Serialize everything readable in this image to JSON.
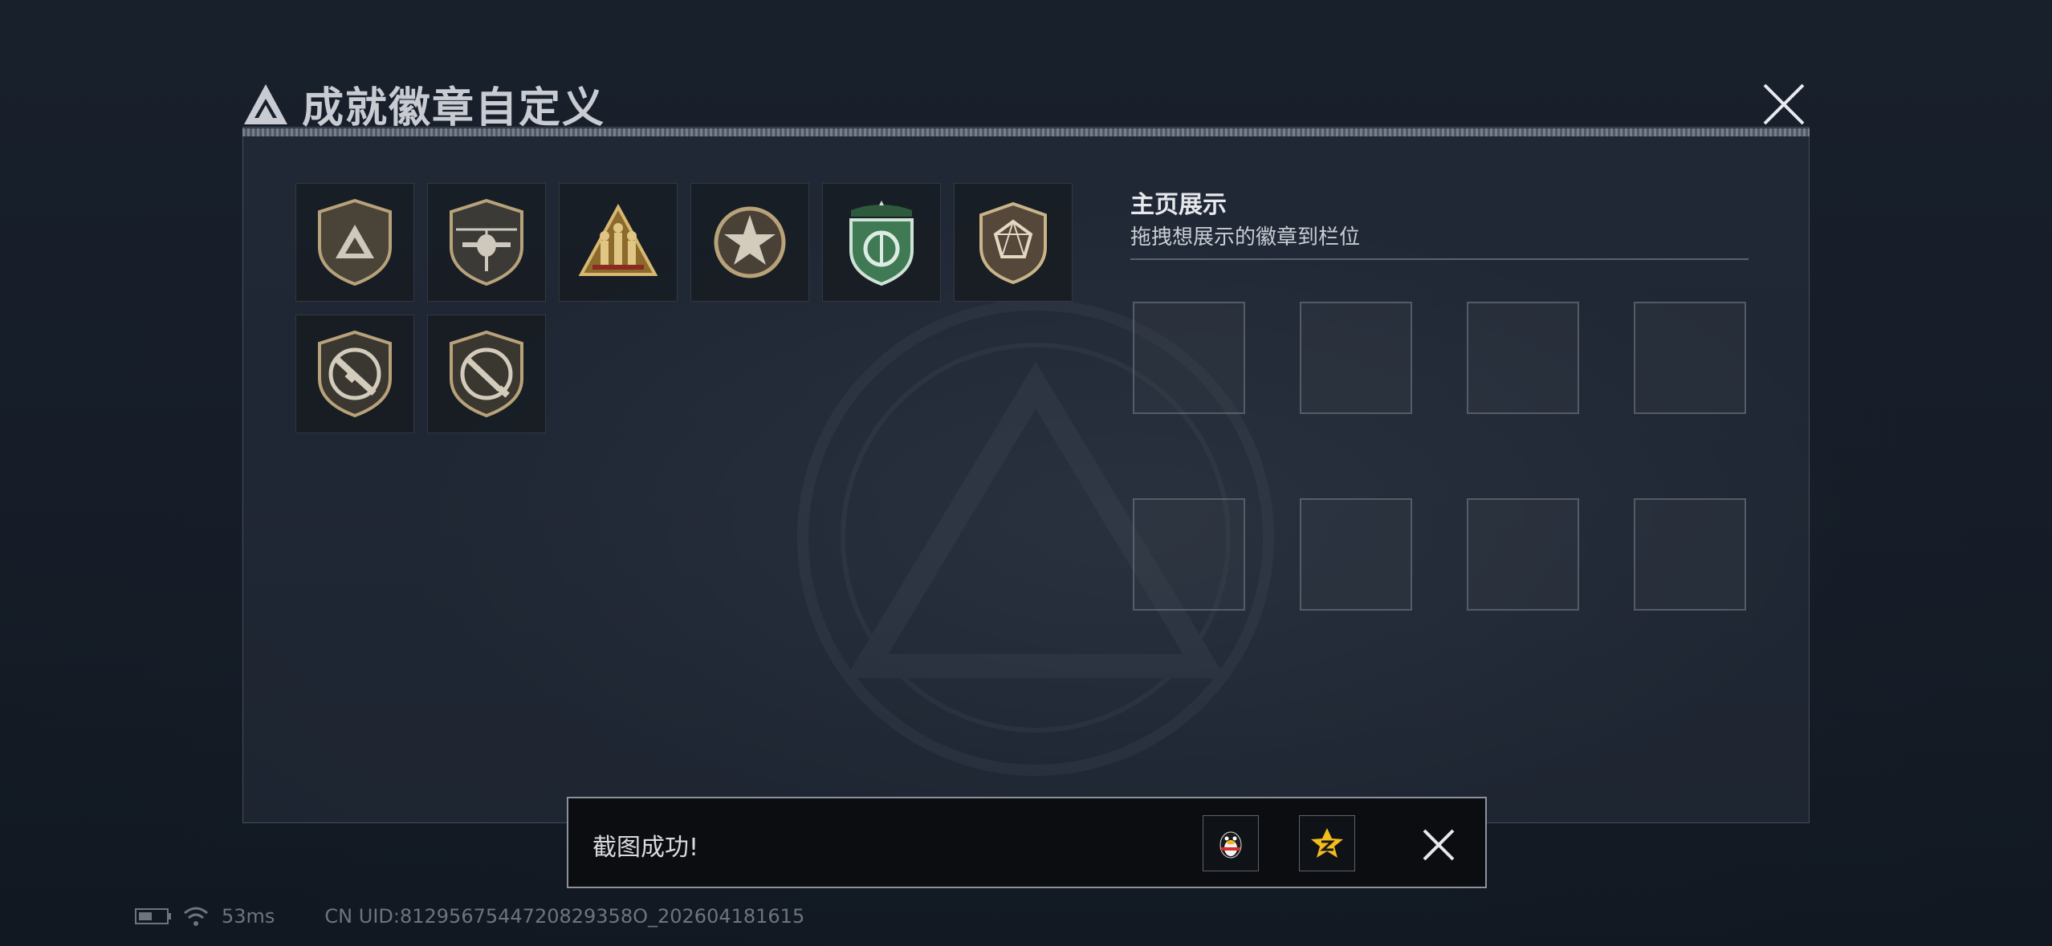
{
  "header": {
    "title": "成就徽章自定义",
    "logo_icon": "triangle-logo-icon",
    "close_icon": "close-icon"
  },
  "badges": [
    {
      "name": "triangle-shield-badge-icon"
    },
    {
      "name": "helicopter-badge-icon"
    },
    {
      "name": "soldiers-triangle-badge-icon"
    },
    {
      "name": "star-badge-icon"
    },
    {
      "name": "green-shield-badge-icon"
    },
    {
      "name": "gem-shield-badge-icon"
    },
    {
      "name": "rifle-badge-icon"
    },
    {
      "name": "knife-badge-icon"
    }
  ],
  "showcase": {
    "title": "主页展示",
    "subtitle": "拖拽想展示的徽章到栏位",
    "slot_count": 8
  },
  "toast": {
    "message": "截图成功!",
    "share_qq_icon": "qq-penguin-icon",
    "share_qzone_icon": "qzone-star-icon",
    "close_icon": "close-icon"
  },
  "status_bar": {
    "battery_icon": "battery-icon",
    "wifi_icon": "wifi-icon",
    "ping": "53ms",
    "uid": "CN UID:8129567544720829358O_202604181615"
  },
  "colors": {
    "gold": "#b8a27a",
    "green": "#3f7a55",
    "panel_border": "#8b929c",
    "background": "#141a24"
  }
}
